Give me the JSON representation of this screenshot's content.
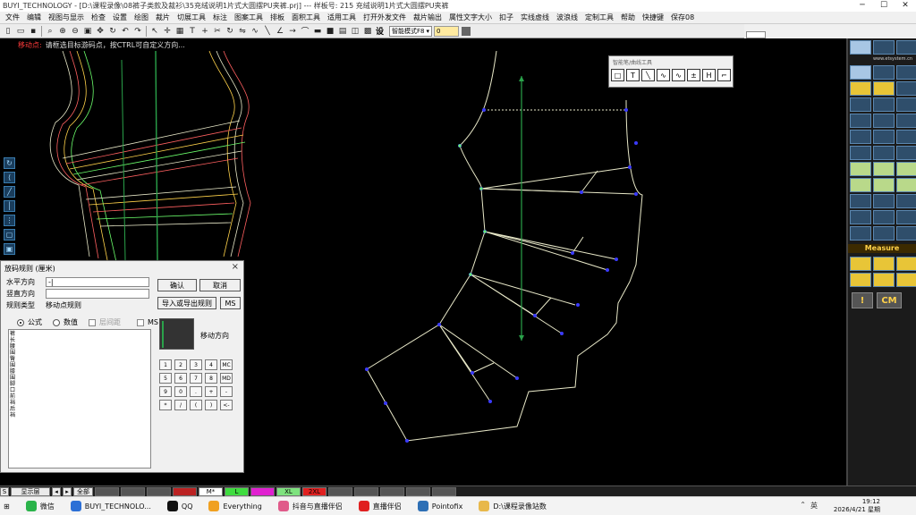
{
  "window": {
    "title": "BUYI_TECHNOLOGY - [D:\\课程录像\\08裤子类款及裁衫\\35充绒说明1片式大圆摆PU夹裤.prj] --- 样板号: 215 充绒说明1片式大圆摆PU夹裤"
  },
  "menu": [
    "文件",
    "编辑",
    "视图与显示",
    "检查",
    "设置",
    "绘图",
    "裁片",
    "切展工具",
    "标注",
    "图案工具",
    "排板",
    "面积工具",
    "适用工具",
    "打开外发文件",
    "裁片输出",
    "属性文字大小",
    "扣子",
    "实线虚线",
    "波浪线",
    "定制工具",
    "帮助",
    "快捷键",
    "保存08"
  ],
  "toolbar": {
    "bold_label": "设",
    "mode": "智能模式F8",
    "value": "0"
  },
  "hint": {
    "label": "移动点:",
    "text": "请框选目标游码点，按CTRL可自定义方向..."
  },
  "float_tools": {
    "title": "智能笔/曲线工具",
    "buttons": [
      "□",
      "T",
      "╲",
      "∿",
      "∿",
      "±",
      "H",
      "⌐"
    ]
  },
  "right_panel": {
    "url": "www.etsystem.cn",
    "measure": "Measure",
    "unit": "CM"
  },
  "dialog": {
    "title": "放码规则 (厘米)",
    "close": "×",
    "h_label": "水平方向",
    "h_value": "-|",
    "v_label": "竖直方向",
    "v_value": "",
    "type_label": "规则类型",
    "type_value": "移动点规则",
    "ok": "确认",
    "cancel": "取消",
    "import_export": "导入或导出规则",
    "ms_btn": "MS",
    "radio_formula": "公式",
    "radio_value": "数值",
    "check_step": "层间距",
    "check_ms": "MS",
    "rule_list": [
      "裤长",
      "腰围",
      "臀围",
      "膝围",
      "脚口",
      "前裆",
      "后裆"
    ],
    "move_dir": "移动方向",
    "keypad": [
      "1",
      "2",
      "3",
      "4",
      "MC",
      "5",
      "6",
      "7",
      "8",
      "MD",
      "9",
      "0",
      ".",
      "+",
      "-",
      "*",
      "/",
      "(",
      ")",
      "<-"
    ]
  },
  "layerbar": {
    "s": "S",
    "layer": "显示层",
    "all": "全部",
    "sizes": [
      "M*",
      "L",
      "XL",
      "2XL"
    ]
  },
  "taskbar": {
    "items": [
      "微信",
      "BUYI_TECHNOLO...",
      "QQ",
      "Everything",
      "抖音与直播伴侣",
      "直播伴侣",
      "Pointofix",
      "D:\\课程录像站数"
    ],
    "ime": "英",
    "time": "19:12",
    "date": "2026/4/21 星期"
  },
  "colors": {
    "canvas": "#000000",
    "pattern_line": "#e8e8c8",
    "grain_line": "#2aa24a",
    "point": "#3a3aff",
    "red_line": "#ff3b3b"
  }
}
